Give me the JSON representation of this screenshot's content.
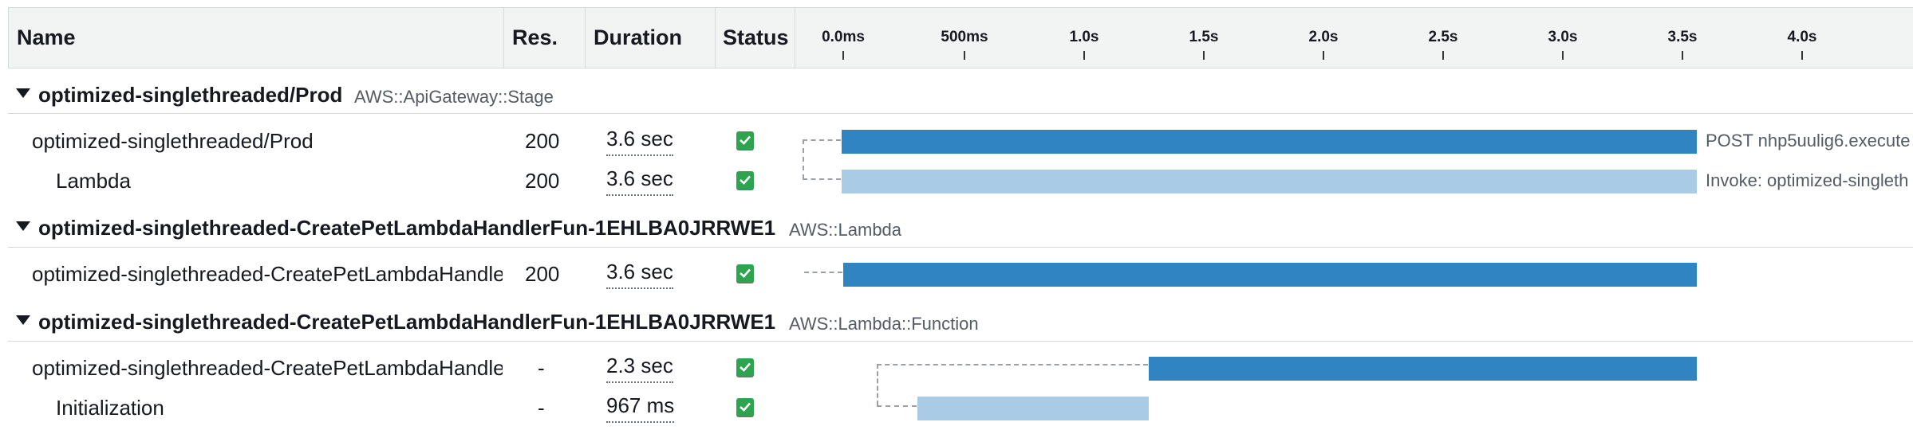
{
  "header": {
    "name": "Name",
    "res": "Res.",
    "duration": "Duration",
    "status": "Status",
    "ticks": [
      "0.0ms",
      "500ms",
      "1.0s",
      "1.5s",
      "2.0s",
      "2.5s",
      "3.0s",
      "3.5s",
      "4.0s"
    ]
  },
  "groups": [
    {
      "name": "optimized-singlethreaded/Prod",
      "type": "AWS::ApiGateway::Stage"
    },
    {
      "name": "optimized-singlethreaded-CreatePetLambdaHandlerFun-1EHLBA0JRRWE1",
      "type": "AWS::Lambda"
    },
    {
      "name": "optimized-singlethreaded-CreatePetLambdaHandlerFun-1EHLBA0JRRWE1",
      "type": "AWS::Lambda::Function"
    }
  ],
  "rows": [
    {
      "name": "optimized-singlethreaded/Prod",
      "res": "200",
      "duration": "3.6 sec",
      "status": "ok",
      "label": "POST nhp5uulig6.execute"
    },
    {
      "name": "Lambda",
      "res": "200",
      "duration": "3.6 sec",
      "status": "ok",
      "label": "Invoke: optimized-singleth"
    },
    {
      "name": "optimized-singlethreaded-CreatePetLambdaHandle",
      "res": "200",
      "duration": "3.6 sec",
      "status": "ok",
      "label": ""
    },
    {
      "name": "optimized-singlethreaded-CreatePetLambdaHandle",
      "res": "-",
      "duration": "2.3 sec",
      "status": "ok",
      "label": ""
    },
    {
      "name": "Initialization",
      "res": "-",
      "duration": "967 ms",
      "status": "ok",
      "label": ""
    }
  ],
  "colors": {
    "bar_dark": "#3184c2",
    "bar_light": "#a9cbe6",
    "status_ok": "#2ea44f"
  }
}
